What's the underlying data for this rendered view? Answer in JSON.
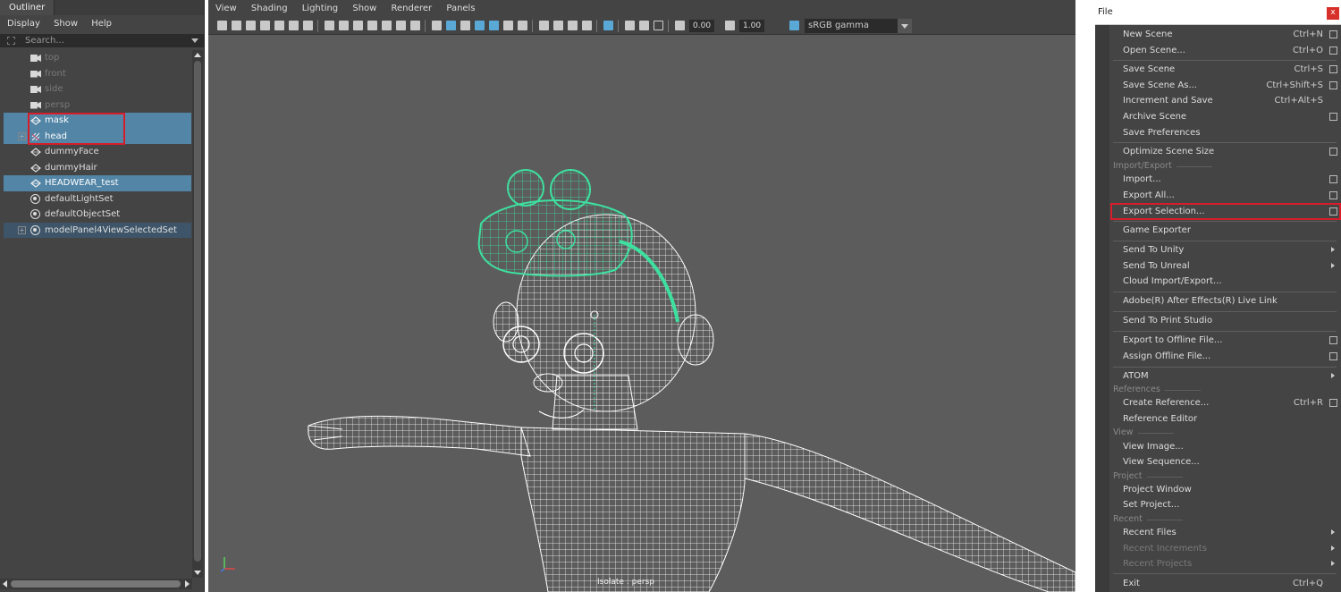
{
  "outliner": {
    "tab": "Outliner",
    "menu": [
      "Display",
      "Show",
      "Help"
    ],
    "search_placeholder": "Search...",
    "items": [
      {
        "label": "top"
      },
      {
        "label": "front"
      },
      {
        "label": "side"
      },
      {
        "label": "persp"
      },
      {
        "label": "mask"
      },
      {
        "label": "head"
      },
      {
        "label": "dummyFace"
      },
      {
        "label": "dummyHair"
      },
      {
        "label": "HEADWEAR_test"
      },
      {
        "label": "defaultLightSet"
      },
      {
        "label": "defaultObjectSet"
      },
      {
        "label": "modelPanel4ViewSelectedSet"
      }
    ]
  },
  "viewport": {
    "menu": [
      "View",
      "Shading",
      "Lighting",
      "Show",
      "Renderer",
      "Panels"
    ],
    "exposure": "0.00",
    "gamma": "1.00",
    "color_space": "sRGB gamma",
    "camera_label": "Isolate : persp",
    "colors": {
      "background": "#5c5c5c",
      "selection_wire": "#3ee0a0",
      "wire": "#ffffff"
    }
  },
  "file_menu": {
    "title": "File",
    "close": "x",
    "sections": {
      "import_export": "Import/Export",
      "references": "References",
      "view": "View",
      "project": "Project",
      "recent": "Recent"
    },
    "items": {
      "new_scene": {
        "label": "New Scene",
        "shortcut": "Ctrl+N"
      },
      "open_scene": {
        "label": "Open Scene...",
        "shortcut": "Ctrl+O"
      },
      "save_scene": {
        "label": "Save Scene",
        "shortcut": "Ctrl+S"
      },
      "save_scene_as": {
        "label": "Save Scene As...",
        "shortcut": "Ctrl+Shift+S"
      },
      "increment_save": {
        "label": "Increment and Save",
        "shortcut": "Ctrl+Alt+S"
      },
      "archive_scene": {
        "label": "Archive Scene"
      },
      "save_preferences": {
        "label": "Save Preferences"
      },
      "optimize_scene_size": {
        "label": "Optimize Scene Size"
      },
      "import": {
        "label": "Import..."
      },
      "export_all": {
        "label": "Export All..."
      },
      "export_selection": {
        "label": "Export Selection..."
      },
      "game_exporter": {
        "label": "Game Exporter"
      },
      "send_to_unity": {
        "label": "Send To Unity"
      },
      "send_to_unreal": {
        "label": "Send To Unreal"
      },
      "cloud_import_export": {
        "label": "Cloud Import/Export..."
      },
      "after_effects_link": {
        "label": "Adobe(R) After Effects(R) Live Link"
      },
      "send_to_print_studio": {
        "label": "Send To Print Studio"
      },
      "export_offline": {
        "label": "Export to Offline File..."
      },
      "assign_offline": {
        "label": "Assign Offline File..."
      },
      "atom": {
        "label": "ATOM"
      },
      "create_reference": {
        "label": "Create Reference...",
        "shortcut": "Ctrl+R"
      },
      "reference_editor": {
        "label": "Reference Editor"
      },
      "view_image": {
        "label": "View Image..."
      },
      "view_sequence": {
        "label": "View Sequence..."
      },
      "project_window": {
        "label": "Project Window"
      },
      "set_project": {
        "label": "Set Project..."
      },
      "recent_files": {
        "label": "Recent Files"
      },
      "recent_increments": {
        "label": "Recent Increments"
      },
      "recent_projects": {
        "label": "Recent Projects"
      },
      "exit": {
        "label": "Exit",
        "shortcut": "Ctrl+Q"
      }
    }
  }
}
